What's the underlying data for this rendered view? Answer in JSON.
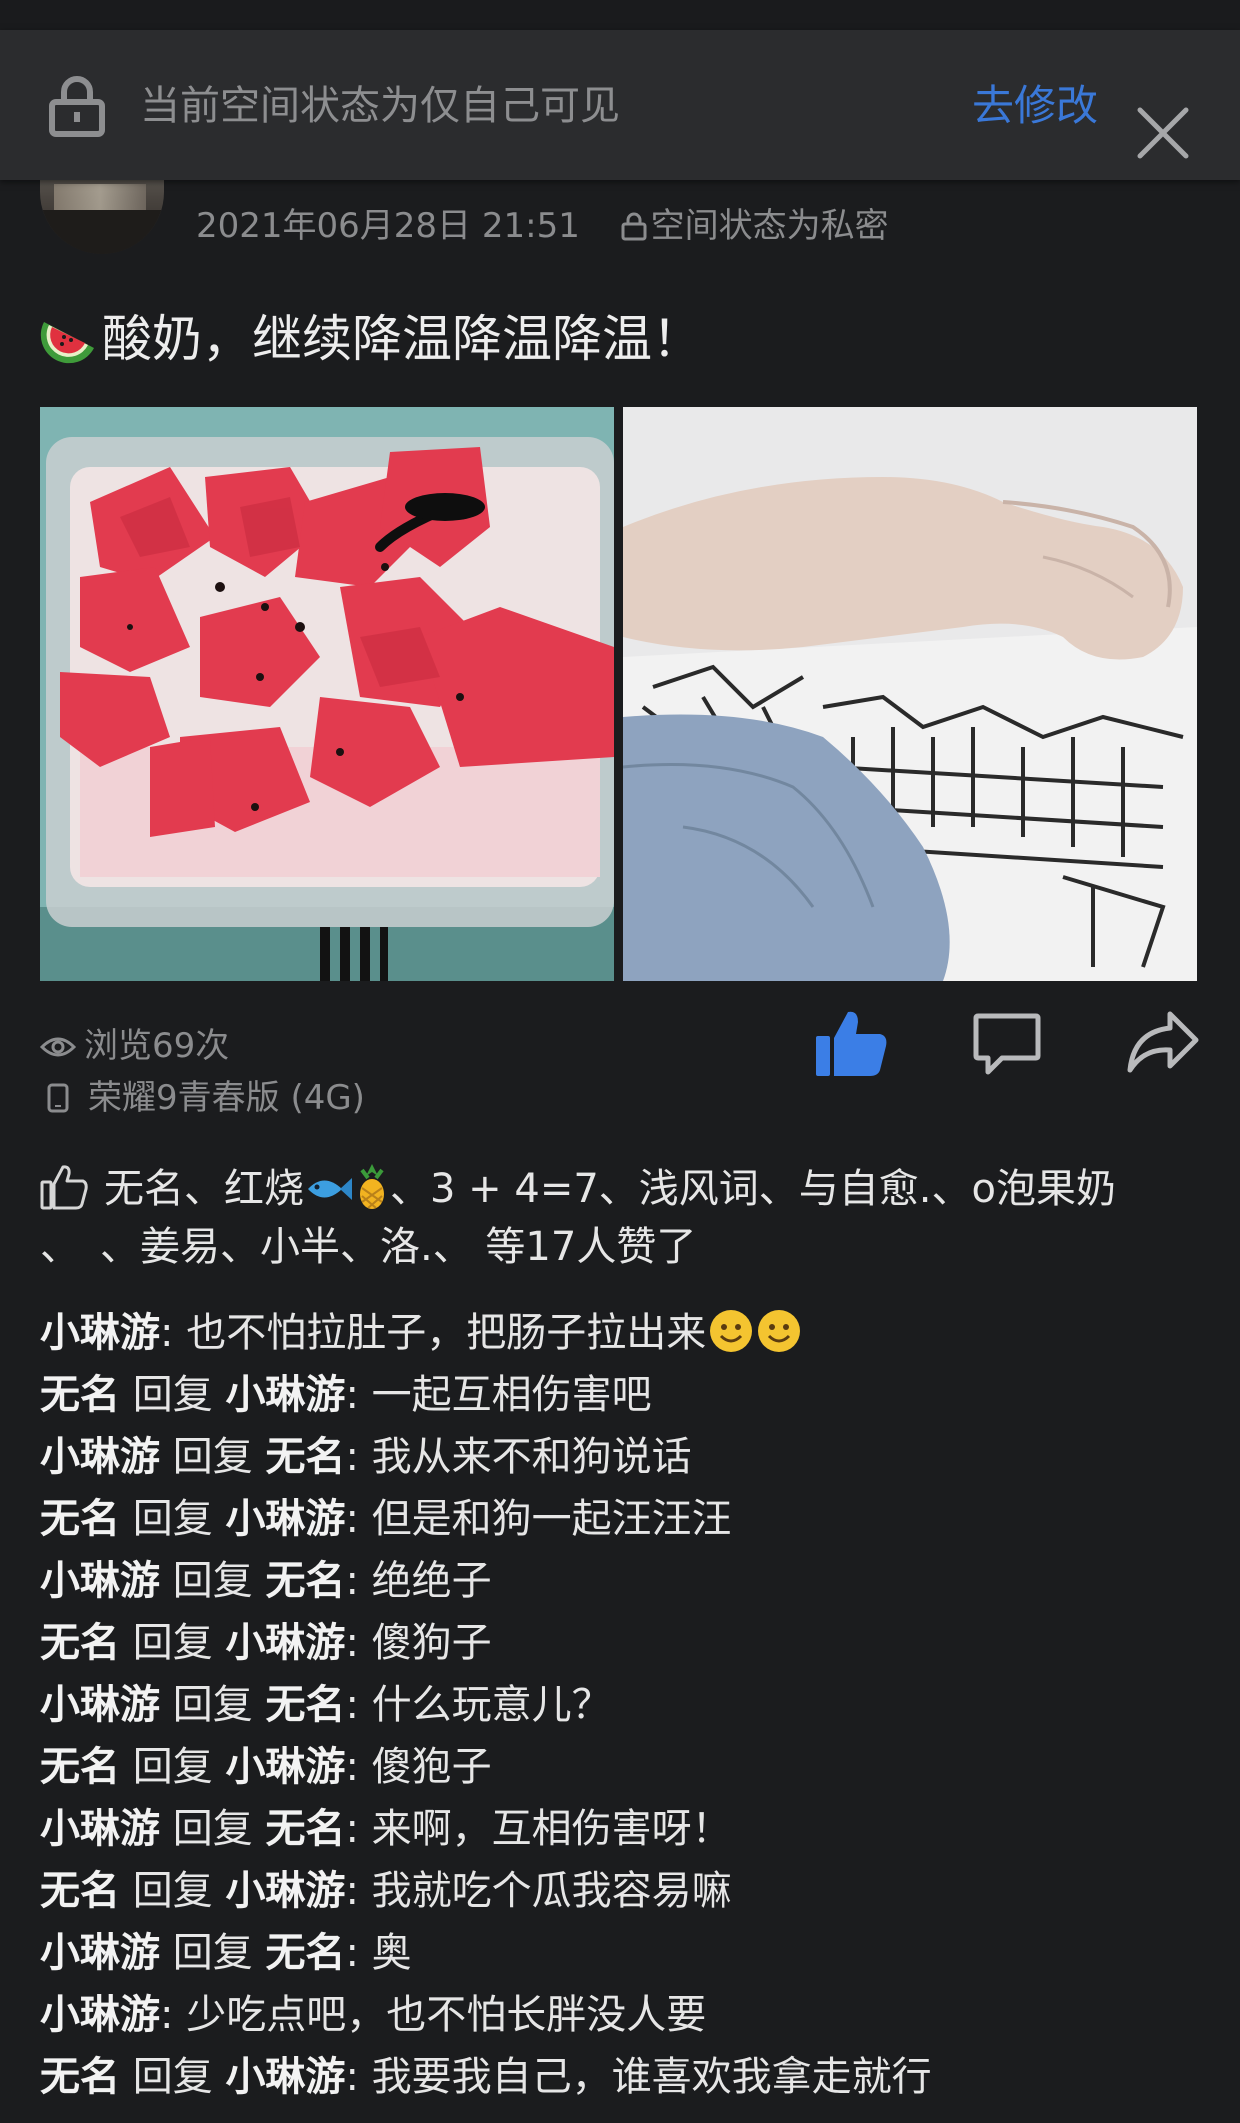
{
  "banner": {
    "message": "当前空间状态为仅自己可见",
    "edit_label": "去修改"
  },
  "post": {
    "timestamp": "2021年06月28日 21:51",
    "privacy_label": "空间状态为私密",
    "text": "酸奶，继续降温降温降温！",
    "text_emoji": "watermelon"
  },
  "stats": {
    "views": "浏览69次",
    "device": "荣耀9青春版 (4G)"
  },
  "likes": {
    "part1": "无名、红烧",
    "part2": "、3 + 4=7、浅风词、与自愈.、o泡果奶",
    "part3": "、　、姜易、小半、洛.、 等17人赞了"
  },
  "comments": [
    {
      "author": "小琳游",
      "reply_word": "",
      "target": "",
      "text": "也不怕拉肚子，把肠子拉出来"
    },
    {
      "author": "无名",
      "reply_word": "回复",
      "target": "小琳游",
      "text": "一起互相伤害吧"
    },
    {
      "author": "小琳游",
      "reply_word": "回复",
      "target": "无名",
      "text": "我从来不和狗说话"
    },
    {
      "author": "无名",
      "reply_word": "回复",
      "target": "小琳游",
      "text": "但是和狗一起汪汪汪"
    },
    {
      "author": "小琳游",
      "reply_word": "回复",
      "target": "无名",
      "text": "绝绝子"
    },
    {
      "author": "无名",
      "reply_word": "回复",
      "target": "小琳游",
      "text": "傻狗子"
    },
    {
      "author": "小琳游",
      "reply_word": "回复",
      "target": "无名",
      "text": "什么玩意儿？"
    },
    {
      "author": "无名",
      "reply_word": "回复",
      "target": "小琳游",
      "text": "傻狍子"
    },
    {
      "author": "小琳游",
      "reply_word": "回复",
      "target": "无名",
      "text": "来啊，互相伤害呀！"
    },
    {
      "author": "无名",
      "reply_word": "回复",
      "target": "小琳游",
      "text": "我就吃个瓜我容易嘛"
    },
    {
      "author": "小琳游",
      "reply_word": "回复",
      "target": "无名",
      "text": "奥"
    },
    {
      "author": "小琳游",
      "reply_word": "",
      "target": "",
      "text": "少吃点吧，也不怕长胖没人要"
    },
    {
      "author": "无名",
      "reply_word": "回复",
      "target": "小琳游",
      "text": "我要我自己，谁喜欢我拿走就行"
    }
  ],
  "colors": {
    "background": "#1b1c1e",
    "banner": "#2b2c2e",
    "accent_blue": "#3a78d8",
    "muted_text": "#8b8c8e"
  }
}
